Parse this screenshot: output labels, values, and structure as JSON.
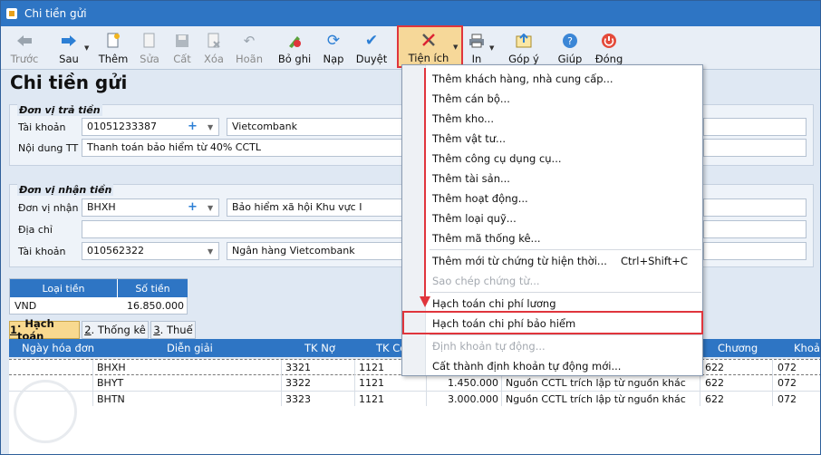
{
  "window": {
    "title": "Chi tiền gửi"
  },
  "toolbar": {
    "items": [
      {
        "label": "Trước",
        "icon": "arrow-left-icon",
        "enabled": false
      },
      {
        "label": "Sau",
        "icon": "arrow-right-icon",
        "enabled": true
      },
      {
        "label": "Thêm",
        "icon": "add-document-icon",
        "enabled": true
      },
      {
        "label": "Sửa",
        "icon": "edit-icon",
        "enabled": false
      },
      {
        "label": "Cất",
        "icon": "save-icon",
        "enabled": false
      },
      {
        "label": "Xóa",
        "icon": "delete-icon",
        "enabled": false
      },
      {
        "label": "Hoãn",
        "icon": "undo-icon",
        "enabled": false
      },
      {
        "label": "Bỏ ghi",
        "icon": "unpost-icon",
        "enabled": true
      },
      {
        "label": "Nạp",
        "icon": "refresh-icon",
        "enabled": true
      },
      {
        "label": "Duyệt",
        "icon": "check-icon",
        "enabled": true
      },
      {
        "label": "Tiện ích",
        "icon": "tools-icon",
        "enabled": true
      },
      {
        "label": "In",
        "icon": "printer-icon",
        "enabled": true
      },
      {
        "label": "Góp ý",
        "icon": "feedback-icon",
        "enabled": true
      },
      {
        "label": "Giúp",
        "icon": "help-icon",
        "enabled": true
      },
      {
        "label": "Đóng",
        "icon": "power-icon",
        "enabled": true
      }
    ]
  },
  "page": {
    "heading": "Chi tiền gửi"
  },
  "payer": {
    "title": "Đơn vị trả tiền",
    "account_label": "Tài khoản",
    "account_value": "01051233387",
    "bank_value": "Vietcombank",
    "content_label": "Nội dung TT",
    "content_value": "Thanh toán bảo hiểm từ 40% CCTL"
  },
  "payee": {
    "title": "Đơn vị nhận tiền",
    "unit_label": "Đơn vị nhận",
    "unit_value": "BHXH",
    "unit_name": "Bảo hiểm xã hội Khu vực I",
    "address_label": "Địa chỉ",
    "address_value": "",
    "account_label": "Tài khoản",
    "account_value": "010562322",
    "bank_value": "Ngân hàng Vietcombank"
  },
  "currency": {
    "col_type": "Loại tiền",
    "col_amount": "Số tiền",
    "type": "VND",
    "amount": "16.850.000"
  },
  "tabs": [
    {
      "num": "1",
      "label": ". Hạch toán",
      "active": true
    },
    {
      "num": "2",
      "label": ". Thống kê",
      "active": false
    },
    {
      "num": "3",
      "label": ". Thuế",
      "active": false
    }
  ],
  "grid": {
    "headers": [
      "Ngày hóa đơn",
      "Diễn giải",
      "TK Nợ",
      "TK Có",
      "",
      "",
      "Chương",
      "Khoản"
    ],
    "rows": [
      {
        "dien_giai": "BHXH",
        "tk_no": "3321",
        "tk_co": "1121",
        "amount": "",
        "note": "",
        "chuong": "622",
        "khoan": "072"
      },
      {
        "dien_giai": "BHYT",
        "tk_no": "3322",
        "tk_co": "1121",
        "amount": "1.450.000",
        "note": "Nguồn CCTL trích lập từ nguồn khác",
        "chuong": "622",
        "khoan": "072"
      },
      {
        "dien_giai": "BHTN",
        "tk_no": "3323",
        "tk_co": "1121",
        "amount": "3.000.000",
        "note": "Nguồn CCTL trích lập từ nguồn khác",
        "chuong": "622",
        "khoan": "072"
      }
    ]
  },
  "menu": {
    "items": [
      {
        "label": "Thêm khách hàng, nhà cung cấp...",
        "enabled": true
      },
      {
        "label": "Thêm cán bộ...",
        "enabled": true
      },
      {
        "label": "Thêm kho...",
        "enabled": true
      },
      {
        "label": "Thêm vật tư...",
        "enabled": true
      },
      {
        "label": "Thêm công cụ dụng cụ...",
        "enabled": true
      },
      {
        "label": "Thêm tài sản...",
        "enabled": true
      },
      {
        "label": "Thêm hoạt động...",
        "enabled": true
      },
      {
        "label": "Thêm loại quỹ...",
        "enabled": true
      },
      {
        "label": "Thêm mã thống kê...",
        "enabled": true
      },
      {
        "label": "Thêm mới từ chứng từ hiện thời...",
        "shortcut": "Ctrl+Shift+C",
        "enabled": true
      },
      {
        "label": "Sao chép chứng từ...",
        "enabled": false
      },
      {
        "label": "Hạch toán chi phí lương",
        "enabled": true
      },
      {
        "label": "Hạch toán chi phí bảo hiểm",
        "enabled": true
      },
      {
        "label": "Định khoản tự động...",
        "enabled": false
      },
      {
        "label": "Cất thành định khoản tự động mới...",
        "enabled": true
      }
    ]
  },
  "colors": {
    "accent": "#2e75c4",
    "highlight": "#e0353c",
    "active_tab": "#f8d98f"
  }
}
